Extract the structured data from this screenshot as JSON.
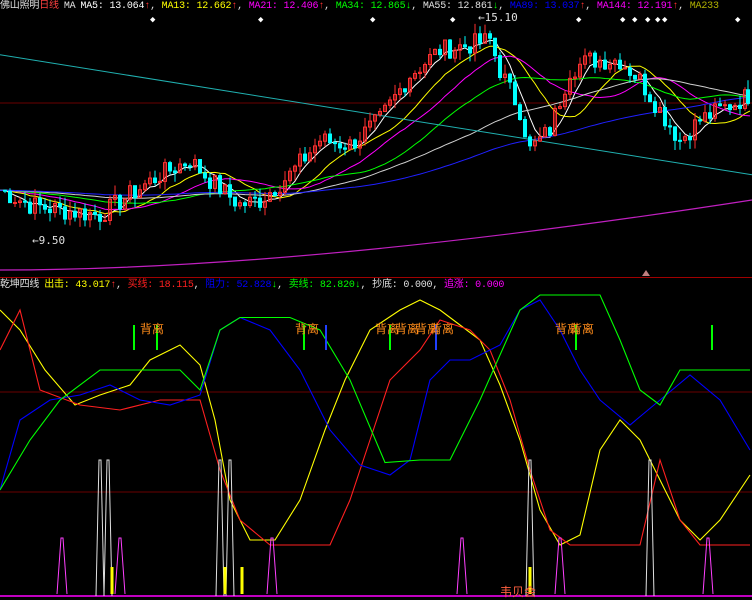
{
  "top_legend": {
    "stock": "佛山照明",
    "period": "日线",
    "ma_label": "MA",
    "items": [
      {
        "name": "MA5",
        "value": "13.064",
        "dir": "↑",
        "color": "#ffffff"
      },
      {
        "name": "MA13",
        "value": "12.662",
        "dir": "↑",
        "color": "#ffff00"
      },
      {
        "name": "MA21",
        "value": "12.406",
        "dir": "↑",
        "color": "#ff00ff"
      },
      {
        "name": "MA34",
        "value": "12.865",
        "dir": "↓",
        "color": "#00ff00"
      },
      {
        "name": "MA55",
        "value": "12.861",
        "dir": "↓",
        "color": "#e0e0e0"
      },
      {
        "name": "MA89",
        "value": "13.037",
        "dir": "↑",
        "color": "#0000ff"
      },
      {
        "name": "MA144",
        "value": "12.191",
        "dir": "↑",
        "color": "#ff00ff"
      },
      {
        "name": "MA233",
        "value": "",
        "dir": "",
        "color": "#b0b000"
      }
    ],
    "high_mark": "15.10",
    "low_mark": "9.50"
  },
  "low_legend": {
    "title": "乾坤四线",
    "items": [
      {
        "name": "出击",
        "value": "43.017",
        "dir": "↑",
        "color": "#ffff00"
      },
      {
        "name": "买线",
        "value": "18.115",
        "dir": "",
        "color": "#ff2020"
      },
      {
        "name": "阻力",
        "value": "52.828",
        "dir": "↓",
        "color": "#0000ff"
      },
      {
        "name": "卖线",
        "value": "82.820",
        "dir": "↓",
        "color": "#00ff00"
      },
      {
        "name": "抄底",
        "value": "0.000",
        "dir": "",
        "color": "#e0e0e0"
      },
      {
        "name": "追涨",
        "value": "0.000",
        "dir": "",
        "color": "#ff00ff"
      }
    ],
    "divergence_label": "背离",
    "bottom_label": "韦贝会"
  },
  "colors": {
    "up": "#ff3030",
    "down": "#00ffff",
    "grid": "#800000"
  },
  "chart_data": [
    {
      "type": "candlestick",
      "title": "佛山照明 日线",
      "ylim": [
        8.6,
        15.5
      ],
      "close_keypoints": [
        [
          0,
          10.75
        ],
        [
          6,
          10.38
        ],
        [
          12,
          10.25
        ],
        [
          20,
          10.13
        ],
        [
          26,
          10.63
        ],
        [
          32,
          11.13
        ],
        [
          38,
          11.5
        ],
        [
          42,
          11.0
        ],
        [
          48,
          10.38
        ],
        [
          52,
          10.5
        ],
        [
          58,
          11.13
        ],
        [
          64,
          12.0
        ],
        [
          70,
          11.88
        ],
        [
          76,
          12.5
        ],
        [
          82,
          13.63
        ],
        [
          88,
          14.25
        ],
        [
          94,
          14.38
        ],
        [
          98,
          14.5
        ],
        [
          100,
          13.75
        ],
        [
          104,
          12.75
        ],
        [
          106,
          11.75
        ],
        [
          110,
          12.25
        ],
        [
          114,
          13.75
        ],
        [
          118,
          14.0
        ],
        [
          124,
          14.0
        ],
        [
          128,
          13.5
        ],
        [
          132,
          12.75
        ],
        [
          136,
          12.0
        ],
        [
          140,
          12.5
        ],
        [
          144,
          12.75
        ],
        [
          148,
          13.0
        ],
        [
          150,
          13.13
        ]
      ],
      "ma_periods": [
        5,
        13,
        21,
        34,
        55,
        89
      ],
      "ma233_line": [
        14.13,
        11.13
      ],
      "ma144_line": [
        8.75,
        10.5
      ],
      "high": 15.1,
      "low": 9.5
    },
    {
      "type": "line",
      "title": "乾坤四线",
      "ylim": [
        0,
        100
      ],
      "series": [
        {
          "name": "出击",
          "color": "#ffff00",
          "points": [
            [
              0,
              94
            ],
            [
              4,
              86
            ],
            [
              9,
              70
            ],
            [
              15,
              56
            ],
            [
              20,
              60
            ],
            [
              26,
              64
            ],
            [
              30,
              74
            ],
            [
              36,
              80
            ],
            [
              40,
              72
            ],
            [
              43,
              50
            ],
            [
              46,
              18
            ],
            [
              50,
              2
            ],
            [
              55,
              2
            ],
            [
              60,
              18
            ],
            [
              65,
              46
            ],
            [
              69,
              66
            ],
            [
              74,
              86
            ],
            [
              80,
              94
            ],
            [
              84,
              98
            ],
            [
              88,
              94
            ],
            [
              92,
              88
            ],
            [
              96,
              82
            ],
            [
              100,
              64
            ],
            [
              104,
              42
            ],
            [
              108,
              14
            ],
            [
              112,
              0
            ],
            [
              116,
              4
            ],
            [
              120,
              38
            ],
            [
              124,
              50
            ],
            [
              128,
              42
            ],
            [
              132,
              26
            ],
            [
              136,
              10
            ],
            [
              140,
              2
            ],
            [
              144,
              10
            ],
            [
              150,
              28
            ]
          ]
        },
        {
          "name": "买线",
          "color": "#ff2020",
          "points": [
            [
              0,
              78
            ],
            [
              4,
              94
            ],
            [
              8,
              62
            ],
            [
              16,
              56
            ],
            [
              24,
              54
            ],
            [
              32,
              58
            ],
            [
              40,
              58
            ],
            [
              44,
              30
            ],
            [
              48,
              10
            ],
            [
              54,
              0
            ],
            [
              60,
              0
            ],
            [
              66,
              0
            ],
            [
              70,
              18
            ],
            [
              74,
              42
            ],
            [
              78,
              66
            ],
            [
              84,
              78
            ],
            [
              88,
              90
            ],
            [
              94,
              86
            ],
            [
              98,
              78
            ],
            [
              102,
              58
            ],
            [
              106,
              30
            ],
            [
              110,
              6
            ],
            [
              114,
              0
            ],
            [
              120,
              0
            ],
            [
              128,
              0
            ],
            [
              132,
              34
            ],
            [
              136,
              10
            ],
            [
              140,
              0
            ],
            [
              150,
              0
            ]
          ]
        },
        {
          "name": "阻力",
          "color": "#0000ff",
          "points": [
            [
              0,
              22
            ],
            [
              4,
              50
            ],
            [
              10,
              58
            ],
            [
              16,
              60
            ],
            [
              22,
              64
            ],
            [
              28,
              58
            ],
            [
              34,
              56
            ],
            [
              40,
              60
            ],
            [
              44,
              86
            ],
            [
              48,
              91
            ],
            [
              54,
              86
            ],
            [
              60,
              70
            ],
            [
              66,
              46
            ],
            [
              72,
              32
            ],
            [
              78,
              28
            ],
            [
              82,
              34
            ],
            [
              86,
              66
            ],
            [
              90,
              74
            ],
            [
              94,
              74
            ],
            [
              100,
              80
            ],
            [
              104,
              94
            ],
            [
              108,
              98
            ],
            [
              112,
              86
            ],
            [
              116,
              70
            ],
            [
              120,
              58
            ],
            [
              126,
              48
            ],
            [
              132,
              58
            ],
            [
              138,
              68
            ],
            [
              144,
              58
            ],
            [
              150,
              38
            ]
          ]
        },
        {
          "name": "卖线",
          "color": "#00ff00",
          "points": [
            [
              0,
              22
            ],
            [
              6,
              42
            ],
            [
              12,
              58
            ],
            [
              20,
              70
            ],
            [
              30,
              70
            ],
            [
              36,
              70
            ],
            [
              40,
              62
            ],
            [
              44,
              86
            ],
            [
              48,
              91
            ],
            [
              58,
              91
            ],
            [
              64,
              86
            ],
            [
              70,
              66
            ],
            [
              77,
              33
            ],
            [
              84,
              34
            ],
            [
              90,
              34
            ],
            [
              96,
              58
            ],
            [
              104,
              94
            ],
            [
              108,
              100
            ],
            [
              120,
              100
            ],
            [
              124,
              82
            ],
            [
              128,
              62
            ],
            [
              132,
              56
            ],
            [
              136,
              70
            ],
            [
              150,
              70
            ]
          ]
        }
      ],
      "white_spikes": [
        20,
        21.6,
        44,
        46,
        106,
        130
      ],
      "magenta_spikes": [
        12.4,
        24,
        54.4,
        92.4,
        112,
        141.6
      ],
      "yellow_bars": [
        22.4,
        45,
        48.4,
        106
      ],
      "green_marks": [
        26.8,
        31.4,
        60.8,
        78,
        115.2,
        142.4
      ],
      "blue_marks": [
        65.2,
        87.2
      ],
      "divergence_at": [
        29,
        60,
        76,
        80,
        84,
        87,
        112,
        115
      ]
    }
  ]
}
